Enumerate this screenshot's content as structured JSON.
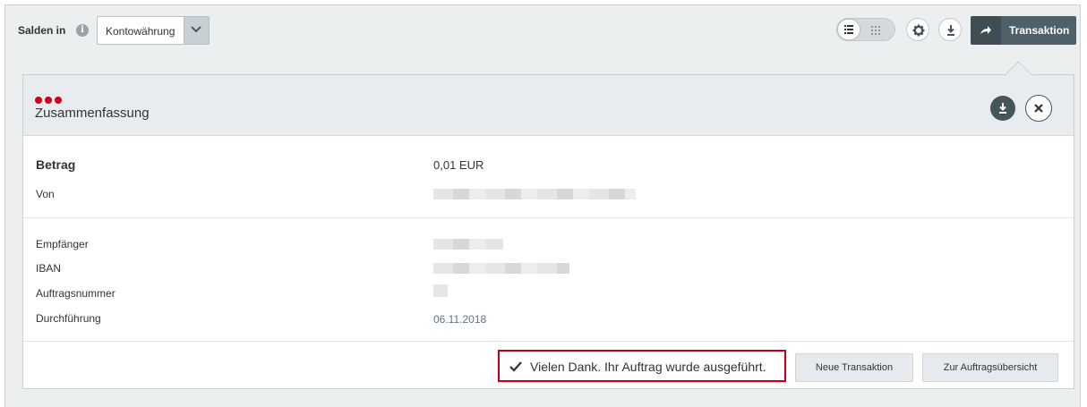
{
  "topbar": {
    "salden_label": "Salden in",
    "currency_select_value": "Kontowährung",
    "transaction_button_label": "Transaktion"
  },
  "panel": {
    "title": "Zusammenfassung",
    "rows": [
      {
        "label": "Betrag",
        "value": "0,01 EUR"
      },
      {
        "label": "Von",
        "value": ""
      },
      {
        "label": "Empfänger",
        "value": ""
      },
      {
        "label": "IBAN",
        "value": ""
      },
      {
        "label": "Auftragsnummer",
        "value": ""
      },
      {
        "label": "Durchführung",
        "value": "06.11.2018"
      }
    ],
    "success_message": "Vielen Dank. Ihr Auftrag wurde ausgeführt.",
    "new_transaction_label": "Neue Transaktion",
    "order_overview_label": "Zur Auftragsübersicht"
  },
  "colors": {
    "accent_red": "#d0001c",
    "dark_button": "#50606a",
    "header_bg": "#e8ecee"
  },
  "icons": [
    "info-icon",
    "chevron-down-icon",
    "list-view-icon",
    "grid-view-icon",
    "gear-icon",
    "download-icon",
    "arrow-right-icon",
    "close-icon",
    "checkmark-icon"
  ]
}
